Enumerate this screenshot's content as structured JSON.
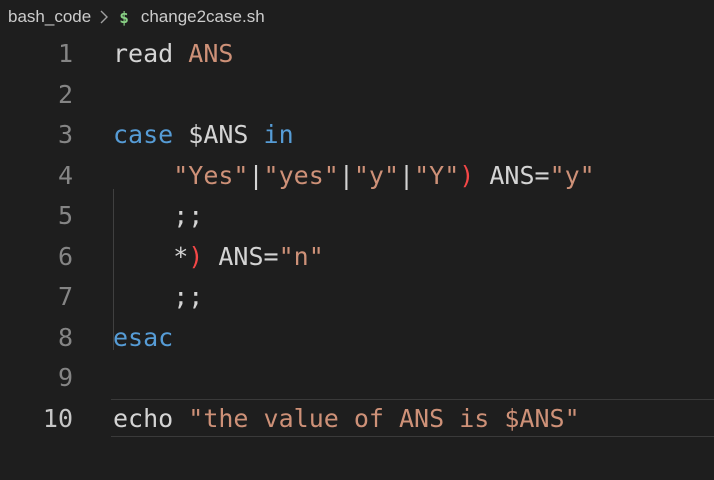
{
  "breadcrumb": {
    "folder": "bash_code",
    "separator_icon": "chevron-right-icon",
    "file_icon": "$",
    "file": "change2case.sh"
  },
  "colors": {
    "background": "#1e1e1e",
    "keyword": "#569cd6",
    "string": "#ce9178",
    "default_text": "#d4d4d4",
    "line_number": "#858585",
    "paren": "#f44747",
    "file_icon": "#89d185"
  },
  "editor": {
    "active_line": 10,
    "lines": [
      {
        "number": "1",
        "tokens": [
          {
            "t": "read",
            "c": "plain"
          },
          {
            "t": " ",
            "c": "plain"
          },
          {
            "t": "ANS",
            "c": "var"
          }
        ]
      },
      {
        "number": "2",
        "tokens": []
      },
      {
        "number": "3",
        "tokens": [
          {
            "t": "case",
            "c": "kw"
          },
          {
            "t": " $ANS ",
            "c": "plain"
          },
          {
            "t": "in",
            "c": "kw"
          }
        ]
      },
      {
        "number": "4",
        "tokens": [
          {
            "t": "    ",
            "c": "plain"
          },
          {
            "t": "\"Yes\"",
            "c": "str"
          },
          {
            "t": "|",
            "c": "plain"
          },
          {
            "t": "\"yes\"",
            "c": "str"
          },
          {
            "t": "|",
            "c": "plain"
          },
          {
            "t": "\"y\"",
            "c": "str"
          },
          {
            "t": "|",
            "c": "plain"
          },
          {
            "t": "\"Y\"",
            "c": "str"
          },
          {
            "t": ")",
            "c": "paren"
          },
          {
            "t": " ANS=",
            "c": "plain"
          },
          {
            "t": "\"y\"",
            "c": "str"
          }
        ]
      },
      {
        "number": "5",
        "tokens": [
          {
            "t": "    ;;",
            "c": "plain"
          }
        ]
      },
      {
        "number": "6",
        "tokens": [
          {
            "t": "    *",
            "c": "plain"
          },
          {
            "t": ")",
            "c": "paren"
          },
          {
            "t": " ANS=",
            "c": "plain"
          },
          {
            "t": "\"n\"",
            "c": "str"
          }
        ]
      },
      {
        "number": "7",
        "tokens": [
          {
            "t": "    ;;",
            "c": "plain"
          }
        ]
      },
      {
        "number": "8",
        "tokens": [
          {
            "t": "esac",
            "c": "kw"
          }
        ]
      },
      {
        "number": "9",
        "tokens": []
      },
      {
        "number": "10",
        "tokens": [
          {
            "t": "echo",
            "c": "plain"
          },
          {
            "t": " ",
            "c": "plain"
          },
          {
            "t": "\"the value of ANS is $ANS\"",
            "c": "str"
          }
        ]
      }
    ]
  }
}
